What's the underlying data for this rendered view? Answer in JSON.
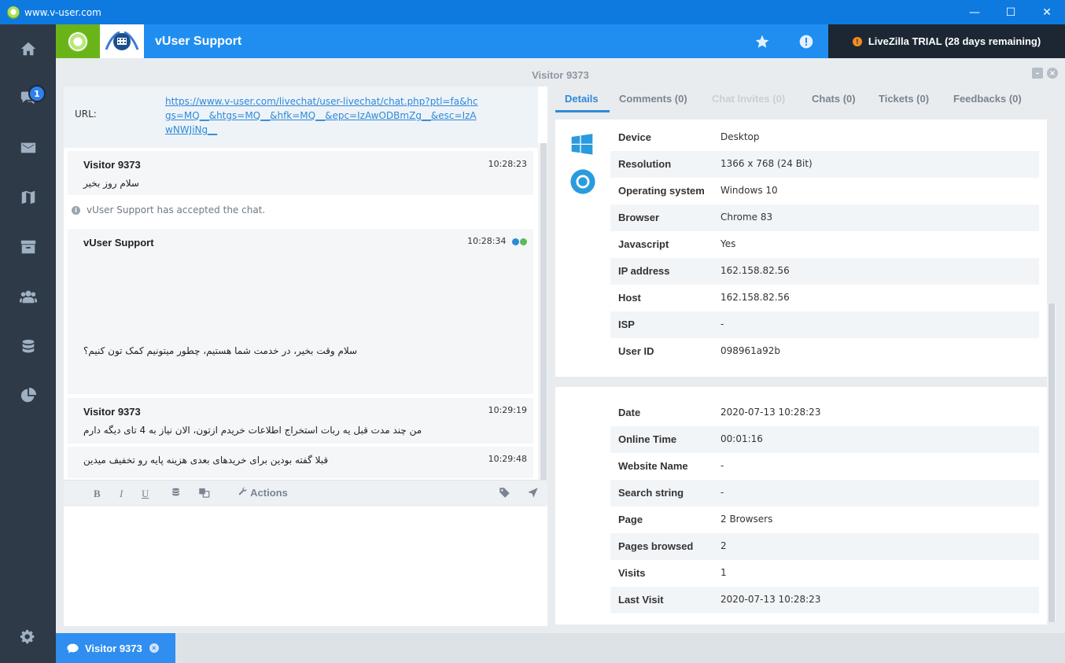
{
  "window": {
    "title": "www.v-user.com",
    "controls": [
      "—",
      "☐",
      "✕"
    ]
  },
  "sidebar": {
    "chat_badge": "1"
  },
  "header": {
    "title": "vUser Support",
    "trial_text": "LiveZilla TRIAL (28 days remaining)"
  },
  "visitor": {
    "title": "Visitor 9373"
  },
  "chat": {
    "url_label": "URL:",
    "url_value": "https://www.v-user.com/livechat/user-livechat/chat.php?ptl=fa&hcgs=MQ__&htgs=MQ__&hfk=MQ__&epc=IzAwODBmZg__&esc=IzAwNWJiNg__",
    "messages": [
      {
        "name": "Visitor 9373",
        "time": "10:28:23",
        "text": "سلام روز بخیر"
      },
      {
        "name": "vUser Support",
        "time": "10:28:34",
        "text": "سلام وقت بخیر، در خدمت شما هستیم، چطور میتونیم کمک تون کنیم؟"
      },
      {
        "name": "Visitor 9373",
        "time": "10:29:19",
        "text": "من چند مدت قبل یه ربات استخراج اطلاعات خریدم ازتون، الان نیاز به 4 تای دیگه دارم"
      },
      {
        "name": "",
        "time": "10:29:48",
        "text": "قبلا گفته بودین برای خریدهای بعدی هزینه پایه رو تخفیف میدین"
      }
    ],
    "system_note": "vUser Support has accepted the chat.",
    "toolbar": {
      "bold": "B",
      "italic": "I",
      "underline": "U",
      "actions": "Actions"
    }
  },
  "tabs": [
    {
      "label": "Details"
    },
    {
      "label": "Comments (0)"
    },
    {
      "label": "Chat Invites (0)"
    },
    {
      "label": "Chats (0)"
    },
    {
      "label": "Tickets (0)"
    },
    {
      "label": "Feedbacks (0)"
    }
  ],
  "details": [
    {
      "key": "Device",
      "value": "Desktop"
    },
    {
      "key": "Resolution",
      "value": "1366 x 768 (24 Bit)"
    },
    {
      "key": "Operating system",
      "value": "Windows 10"
    },
    {
      "key": "Browser",
      "value": "Chrome 83"
    },
    {
      "key": "Javascript",
      "value": "Yes"
    },
    {
      "key": "IP address",
      "value": "162.158.82.56"
    },
    {
      "key": "Host",
      "value": "162.158.82.56"
    },
    {
      "key": "ISP",
      "value": "-"
    },
    {
      "key": "User ID",
      "value": "098961a92b"
    }
  ],
  "details2": [
    {
      "key": "Date",
      "value": "2020-07-13 10:28:23"
    },
    {
      "key": "Online Time",
      "value": "00:01:16"
    },
    {
      "key": "Website Name",
      "value": "-"
    },
    {
      "key": "Search string",
      "value": "-"
    },
    {
      "key": "Page",
      "value": "2 Browsers"
    },
    {
      "key": "Pages browsed",
      "value": "2"
    },
    {
      "key": "Visits",
      "value": "1"
    },
    {
      "key": "Last Visit",
      "value": "2020-07-13 10:28:23"
    }
  ],
  "bottom": {
    "tab_label": "Visitor 9373"
  },
  "colors": {
    "accent": "#1f8ef0",
    "sidebar": "#2e3a47",
    "brand_green": "#6ab41a",
    "trial_bg": "#1c2733"
  }
}
